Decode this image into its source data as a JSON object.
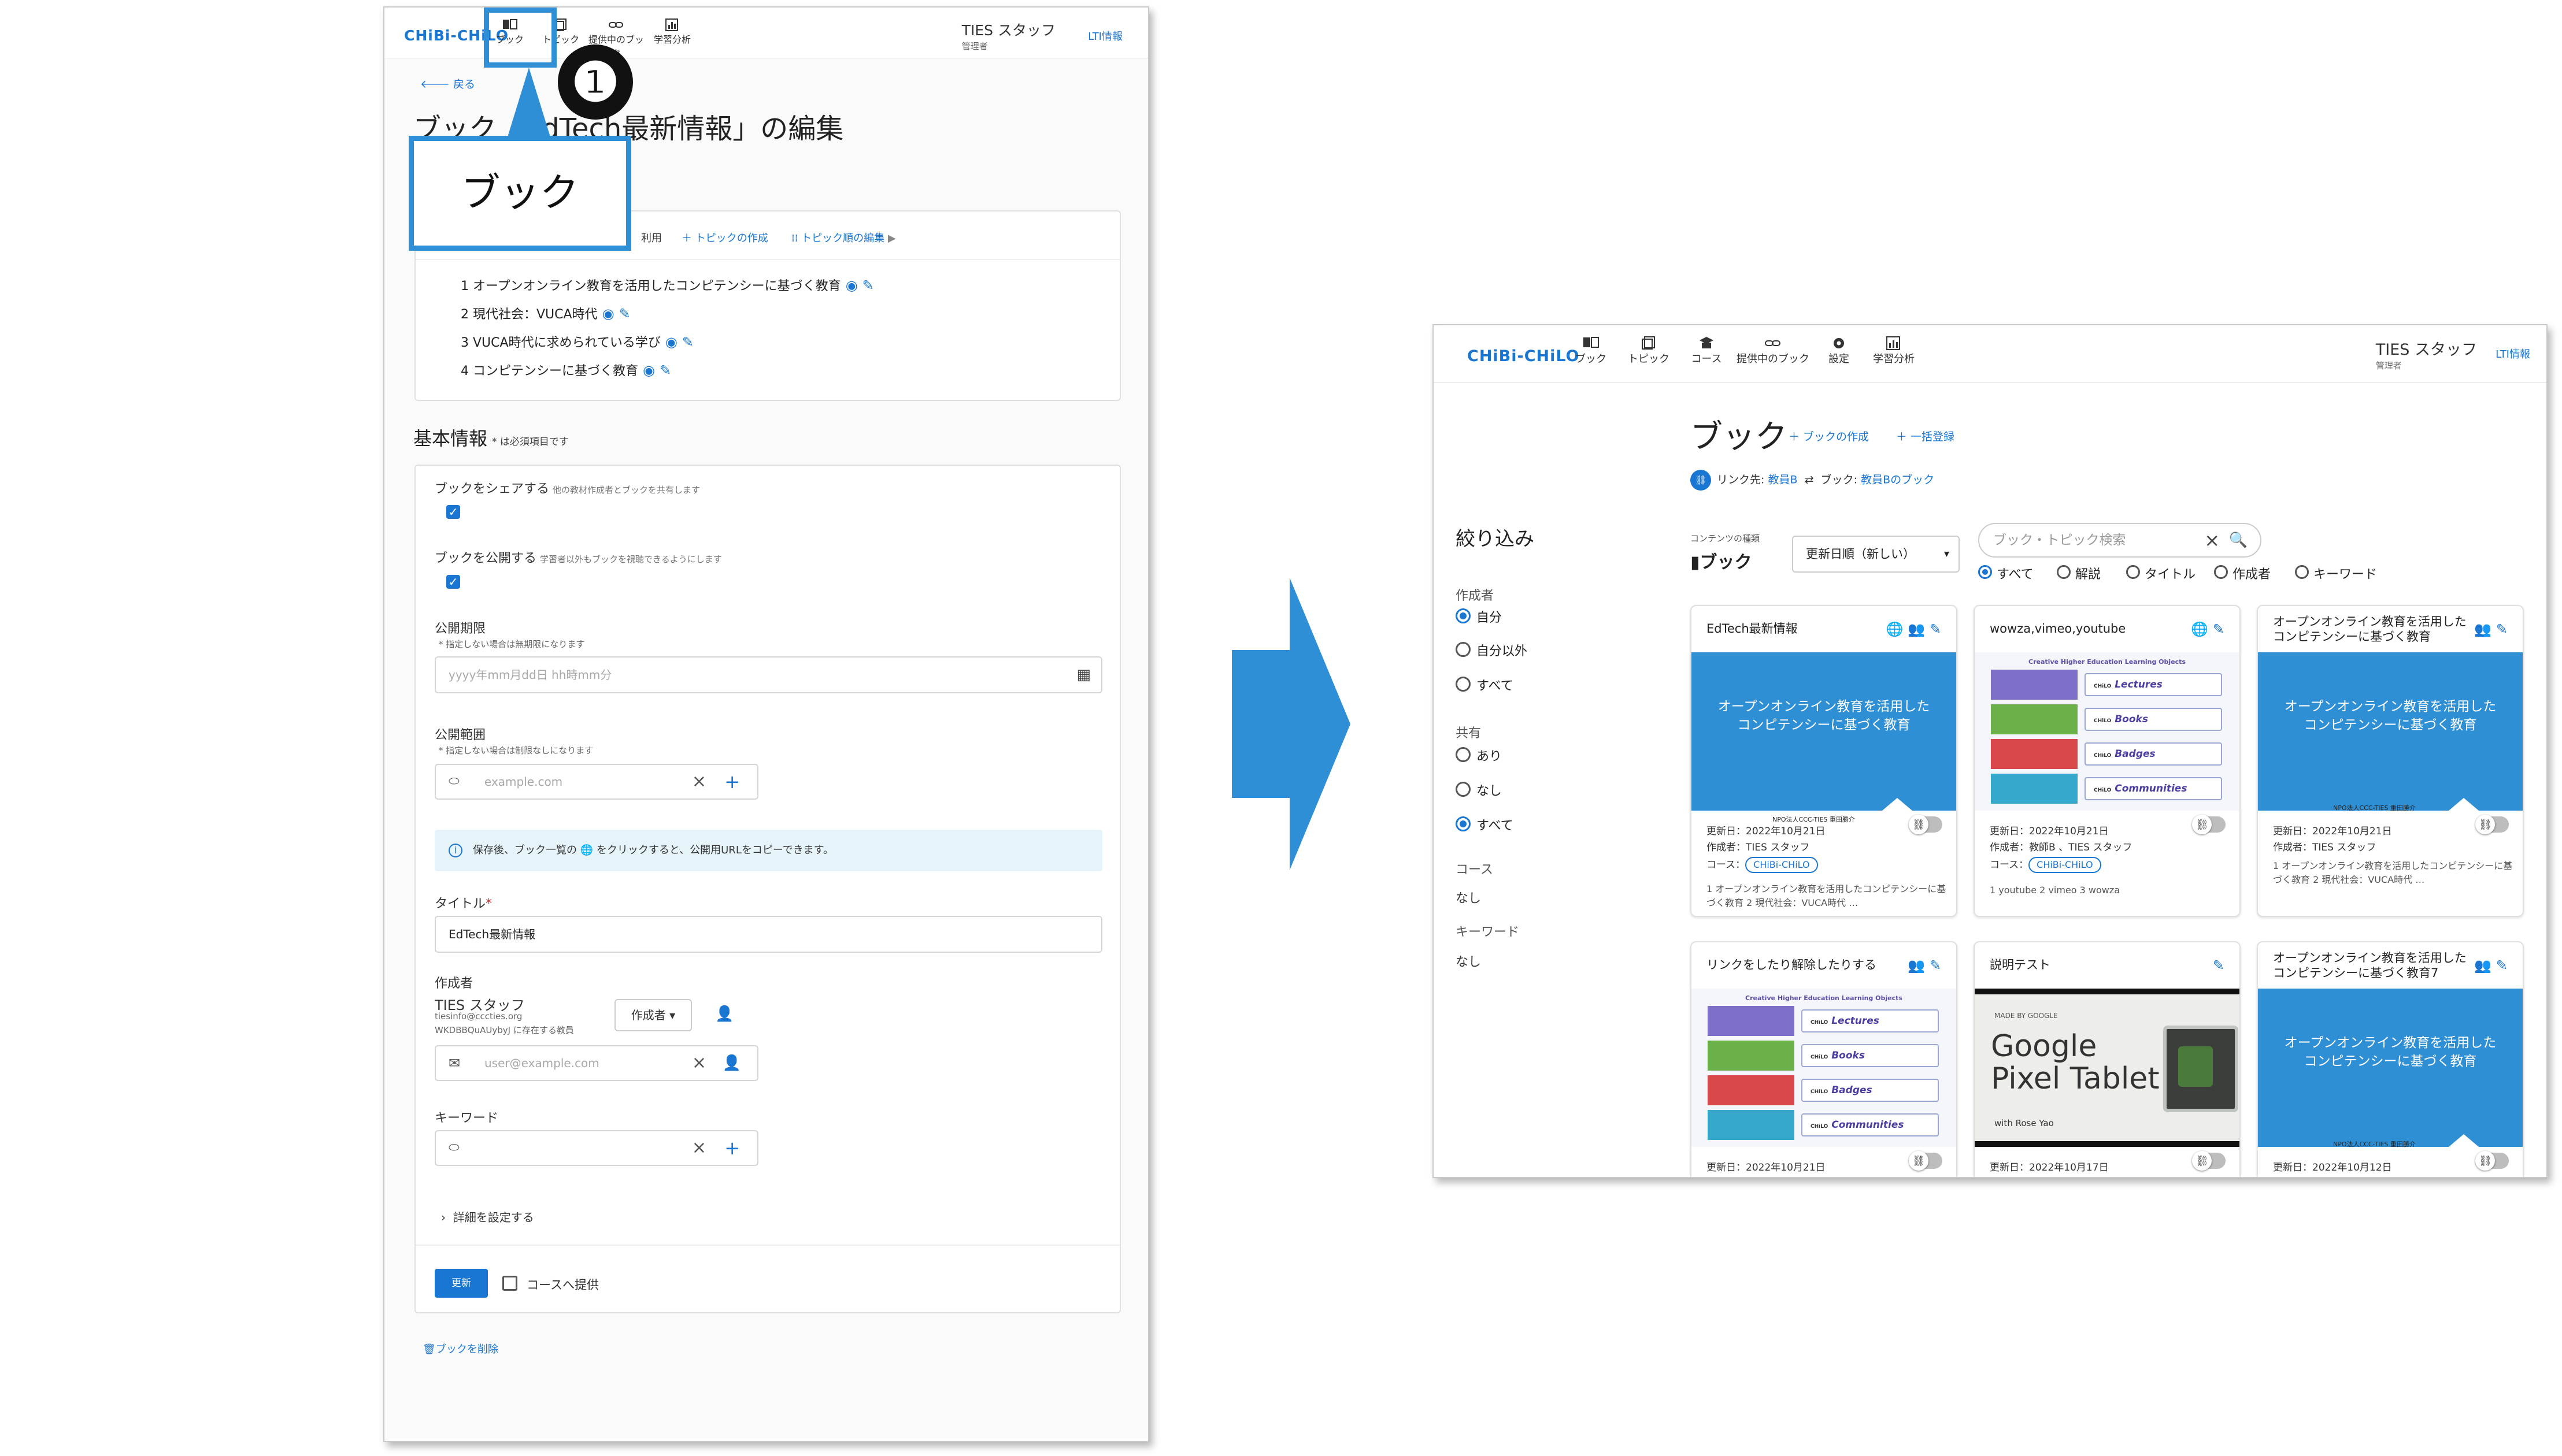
{
  "left": {
    "logo": "CHiBi-CHiLO",
    "nav": [
      {
        "label": "ブック",
        "icon": "book-icon"
      },
      {
        "label": "トピック",
        "icon": "topic-icon"
      },
      {
        "label": "提供中のブック",
        "icon": "link-icon"
      },
      {
        "label": "学習分析",
        "icon": "analytics-icon"
      }
    ],
    "user_name": "TIES スタッフ",
    "user_role": "管理者",
    "lti": "LTI情報",
    "badge": "❶",
    "callout": "ブック",
    "back": "戻る",
    "page_title": "ブック「EdTech最新情報」の編集",
    "topic_toolbar": {
      "reuse": "利用",
      "create": "トピックの作成",
      "reorder": "トピック順の編集"
    },
    "topics": [
      "1 オープンオンライン教育を活用したコンピテンシーに基づく教育",
      "2 現代社会：VUCA時代",
      "3 VUCA時代に求められている学び",
      "4 コンピテンシーに基づく教育"
    ],
    "basic_info": "基本情報",
    "required_note": "* は必須項目です",
    "share_label": "ブックをシェアする",
    "share_hint": "他の教材作成者とブックを共有します",
    "publish_label": "ブックを公開する",
    "publish_hint": "学習者以外もブックを視聴できるようにします",
    "period_label": "公開期限",
    "period_hint": "* 指定しない場合は無期限になります",
    "period_placeholder": "yyyy年mm月dd日 hh時mm分",
    "scope_label": "公開範囲",
    "scope_hint": "* 指定しない場合は制限なしになります",
    "scope_placeholder": "example.com",
    "info_text": "保存後、ブック一覧の 🌐 をクリックすると、公開用URLをコピーできます。",
    "title_label": "タイトル",
    "title_value": "EdTech最新情報",
    "author_label": "作成者",
    "author_name": "TIES スタッフ",
    "author_email": "tiesinfo@cccties.org",
    "author_note": "WKDBBQuAUybyJ に存在する教員",
    "author_role": "作成者",
    "email_placeholder": "user@example.com",
    "keyword_label": "キーワード",
    "details": "詳細を設定する",
    "update": "更新",
    "offer_course": "コースへ提供",
    "delete": "ブックを削除"
  },
  "right": {
    "logo": "CHiBi-CHiLO",
    "nav": [
      {
        "label": "ブック",
        "icon": "book-icon"
      },
      {
        "label": "トピック",
        "icon": "topic-icon"
      },
      {
        "label": "コース",
        "icon": "course-icon"
      },
      {
        "label": "提供中のブック",
        "icon": "link-icon"
      },
      {
        "label": "設定",
        "icon": "gear-icon"
      },
      {
        "label": "学習分析",
        "icon": "analytics-icon"
      }
    ],
    "user_name": "TIES スタッフ",
    "user_role": "管理者",
    "lti": "LTI情報",
    "title": "ブック",
    "create": "ブックの作成",
    "bulk": "一括登録",
    "link_label": "リンク先:",
    "link_teacher": "教員B",
    "link_book_label": "ブック:",
    "link_book": "教員Bのブック",
    "filter_title": "絞り込み",
    "filter_author": "作成者",
    "author_opts": [
      "自分",
      "自分以外",
      "すべて"
    ],
    "filter_share": "共有",
    "share_opts": [
      "あり",
      "なし",
      "すべて"
    ],
    "filter_course": "コース",
    "course_value": "なし",
    "filter_keyword": "キーワード",
    "keyword_value": "なし",
    "content_type_label": "コンテンツの種類",
    "content_type": "ブック",
    "sort": "更新日順（新しい）",
    "search_placeholder": "ブック・トピック検索",
    "search_opts": [
      "すべて",
      "解説",
      "タイトル",
      "作成者",
      "キーワード"
    ],
    "cards": [
      {
        "title": "EdTech最新情報",
        "thumb": "オープンオンライン教育を活用した\nコンピテンシーに基づく教育",
        "foot": "NPO法人CCC-TIES 重田勝介",
        "updated": "更新日：2022年10月21日",
        "author": "作成者：TIES スタッフ",
        "course_label": "コース：",
        "course": "CHiBi-CHiLO",
        "desc": "1 オープンオンライン教育を活用したコンピテンシーに基づく教育 2 現代社会：VUCA時代 …"
      },
      {
        "title": "wowza,vimeo,youtube",
        "updated": "更新日：2022年10月21日",
        "author": "作成者：教師B 、TIES スタッフ",
        "course_label": "コース：",
        "course": "CHiBi-CHiLO",
        "desc": "1 youtube 2 vimeo 3 wowza"
      },
      {
        "title": "オープンオンライン教育を活用したコンピテンシーに基づく教育",
        "thumb": "オープンオンライン教育を活用した\nコンピテンシーに基づく教育",
        "foot": "NPO法人CCC-TIES 重田勝介",
        "updated": "更新日：2022年10月21日",
        "author": "作成者：TIES スタッフ",
        "desc": "1 オープンオンライン教育を活用したコンピテンシーに基づく教育 2 現代社会：VUCA時代 …"
      },
      {
        "title": "リンクをしたり解除したりする",
        "updated": "更新日：2022年10月21日"
      },
      {
        "title": "説明テスト",
        "updated": "更新日：2022年10月17日",
        "pix_small": "MADE BY GOOGLE",
        "pix_big": "Google\nPixel Tablet",
        "pix_with": "with Rose Yao"
      },
      {
        "title": "オープンオンライン教育を活用したコンピテンシーに基づく教育7",
        "thumb": "オープンオンライン教育を活用した\nコンピテンシーに基づく教育",
        "foot": "NPO法人CCC-TIES 重田勝介",
        "updated": "更新日：2022年10月12日"
      }
    ],
    "edu": {
      "head": "Creative Higher Education Learning Objects",
      "rows": [
        "Lectures",
        "Books",
        "Badges",
        "Communities"
      ],
      "prefix": "CHiLO"
    }
  },
  "colors": {
    "accent": "#1976d2",
    "callout": "#2e8fd6",
    "thumb_blue": "#2f8fd4"
  }
}
